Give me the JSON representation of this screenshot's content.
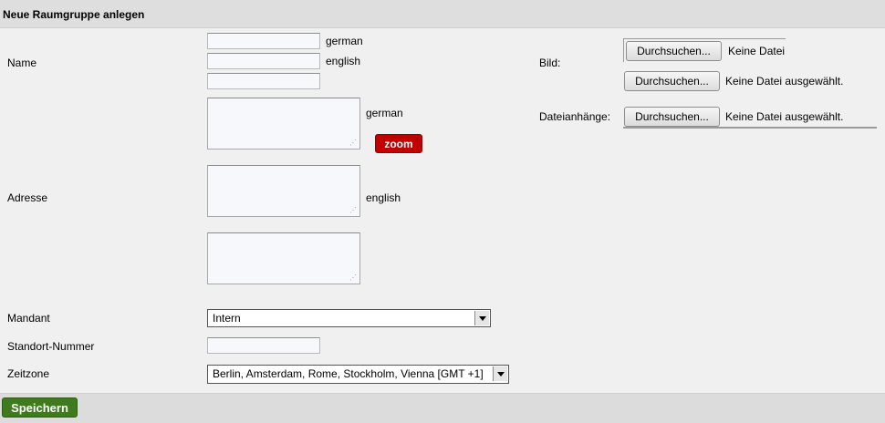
{
  "header": {
    "title": "Neue Raumgruppe anlegen"
  },
  "form": {
    "name": {
      "label": "Name",
      "lang1": "german",
      "lang2": "english"
    },
    "address": {
      "label": "Adresse",
      "lang1": "german",
      "lang2": "english",
      "zoom": "zoom"
    },
    "client": {
      "label": "Mandant",
      "value": "Intern"
    },
    "site_number": {
      "label": "Standort-Nummer"
    },
    "timezone": {
      "label": "Zeitzone",
      "value": "Berlin, Amsterdam, Rome, Stockholm, Vienna [GMT +1]"
    },
    "image": {
      "label": "Bild:",
      "browse1": "Durchsuchen...",
      "status1": "Keine Datei",
      "browse2": "Durchsuchen...",
      "status2": "Keine Datei ausgewählt."
    },
    "attachments": {
      "label": "Dateianhänge:",
      "browse": "Durchsuchen...",
      "status": "Keine Datei ausgewählt."
    }
  },
  "footer": {
    "save": "Speichern"
  },
  "colors": {
    "zoom": "#c00000",
    "save": "#3f7a1f",
    "header_bg": "#dedede"
  }
}
